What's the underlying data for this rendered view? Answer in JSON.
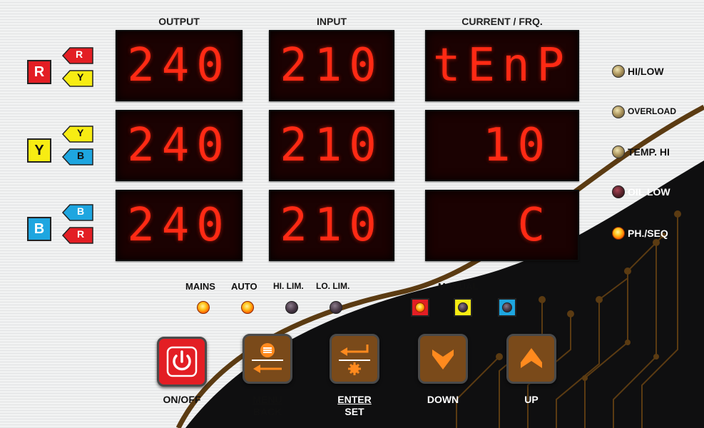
{
  "headers": {
    "output": "OUTPUT",
    "input": "INPUT",
    "current": "CURRENT / FRQ."
  },
  "phases": [
    {
      "name": "R",
      "color": "#e31e24",
      "text_color": "#ffffff",
      "arrow_top": "R",
      "arrow_bottom": "Y"
    },
    {
      "name": "Y",
      "color": "#f7ec13",
      "text_color": "#111111",
      "arrow_top": "Y",
      "arrow_bottom": "B"
    },
    {
      "name": "B",
      "color": "#1ea6e0",
      "text_color": "#ffffff",
      "arrow_top": "B",
      "arrow_bottom": "R"
    }
  ],
  "displays": {
    "output": [
      "240",
      "240",
      "240"
    ],
    "input": [
      "210",
      "210",
      "210"
    ],
    "current": [
      "tEnP",
      "10",
      "C"
    ]
  },
  "indicators": [
    {
      "label": "HI/LOW",
      "state": "dim"
    },
    {
      "label": "OVERLOAD",
      "state": "dim"
    },
    {
      "label": "TEMP. HI",
      "state": "dim"
    },
    {
      "label": "OIL LOW",
      "state": "red"
    },
    {
      "label": "PH./SEQ",
      "state": "on"
    }
  ],
  "status_leds": [
    {
      "label": "MAINS",
      "state": "on"
    },
    {
      "label": "AUTO",
      "state": "on"
    },
    {
      "label": "HI. LIM.",
      "state": "off"
    },
    {
      "label": "LO. LIM.",
      "state": "off"
    }
  ],
  "manual": {
    "label": "MANUAL",
    "leds": [
      {
        "box_color": "#e31e24",
        "state": "on"
      },
      {
        "box_color": "#f7ec13",
        "state": "off"
      },
      {
        "box_color": "#1ea6e0",
        "state": "off"
      }
    ]
  },
  "buttons": {
    "onoff": {
      "label": "ON/OFF",
      "color": "#e31e24"
    },
    "menu": {
      "label_top": "MENU",
      "label_bottom": "BACK",
      "color": "#7a4a1a"
    },
    "enter": {
      "label_top": "ENTER",
      "label_bottom": "SET",
      "color": "#7a4a1a"
    },
    "down": {
      "label": "DOWN",
      "color": "#7a4a1a"
    },
    "up": {
      "label": "UP",
      "color": "#7a4a1a"
    }
  },
  "accent_color": "#ff8a1e"
}
